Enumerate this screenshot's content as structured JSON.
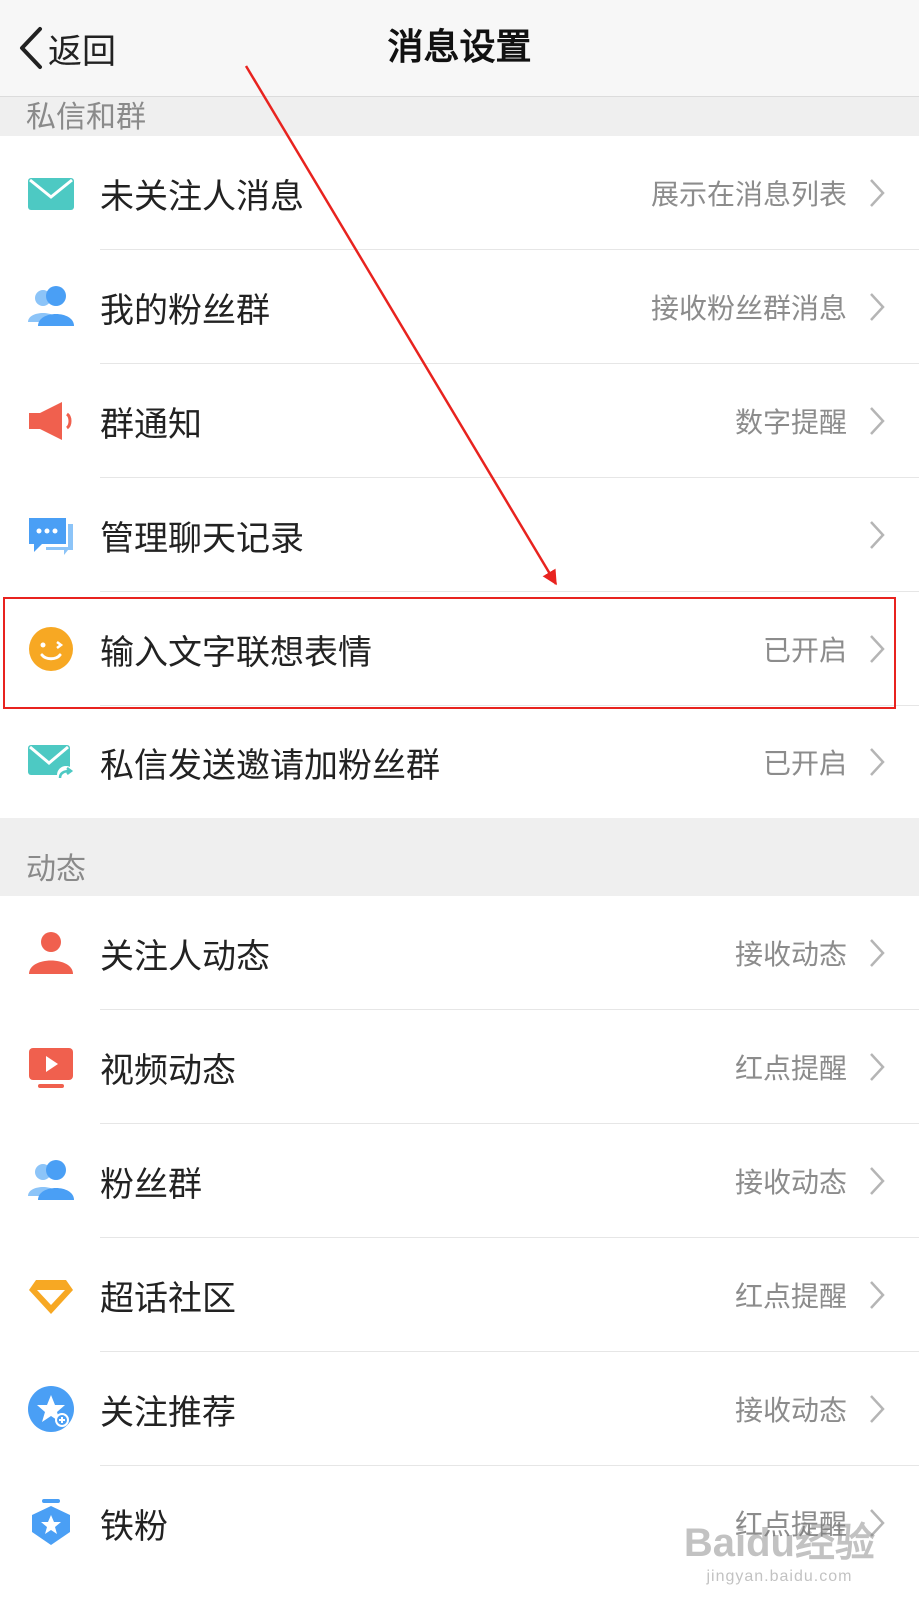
{
  "nav": {
    "back_label": "返回",
    "title": "消息设置"
  },
  "sections": {
    "private": {
      "header": "私信和群",
      "items": [
        {
          "label": "未关注人消息",
          "value": "展示在消息列表",
          "icon": "envelope-icon",
          "color": "#4dc9c3"
        },
        {
          "label": "我的粉丝群",
          "value": "接收粉丝群消息",
          "icon": "fans-group-icon",
          "color": "#4a9ff5"
        },
        {
          "label": "群通知",
          "value": "数字提醒",
          "icon": "megaphone-icon",
          "color": "#f0604e"
        },
        {
          "label": "管理聊天记录",
          "value": "",
          "icon": "chat-bubble-icon",
          "color": "#4a9ff5"
        },
        {
          "label": "输入文字联想表情",
          "value": "已开启",
          "icon": "smiley-icon",
          "color": "#f7a823"
        },
        {
          "label": "私信发送邀请加粉丝群",
          "value": "已开启",
          "icon": "envelope-share-icon",
          "color": "#4dc9c3"
        }
      ]
    },
    "feed": {
      "header": "动态",
      "items": [
        {
          "label": "关注人动态",
          "value": "接收动态",
          "icon": "person-icon",
          "color": "#f0604e"
        },
        {
          "label": "视频动态",
          "value": "红点提醒",
          "icon": "video-icon",
          "color": "#f0604e"
        },
        {
          "label": "粉丝群",
          "value": "接收动态",
          "icon": "fans-group-icon",
          "color": "#4a9ff5"
        },
        {
          "label": "超话社区",
          "value": "红点提醒",
          "icon": "diamond-icon",
          "color": "#f7a823"
        },
        {
          "label": "关注推荐",
          "value": "接收动态",
          "icon": "star-badge-icon",
          "color": "#4a9ff5"
        },
        {
          "label": "铁粉",
          "value": "红点提醒",
          "icon": "shield-badge-icon",
          "color": "#4a9ff5"
        }
      ]
    }
  },
  "watermark": {
    "brand": "Baidu经验",
    "url": "jingyan.baidu.com"
  }
}
